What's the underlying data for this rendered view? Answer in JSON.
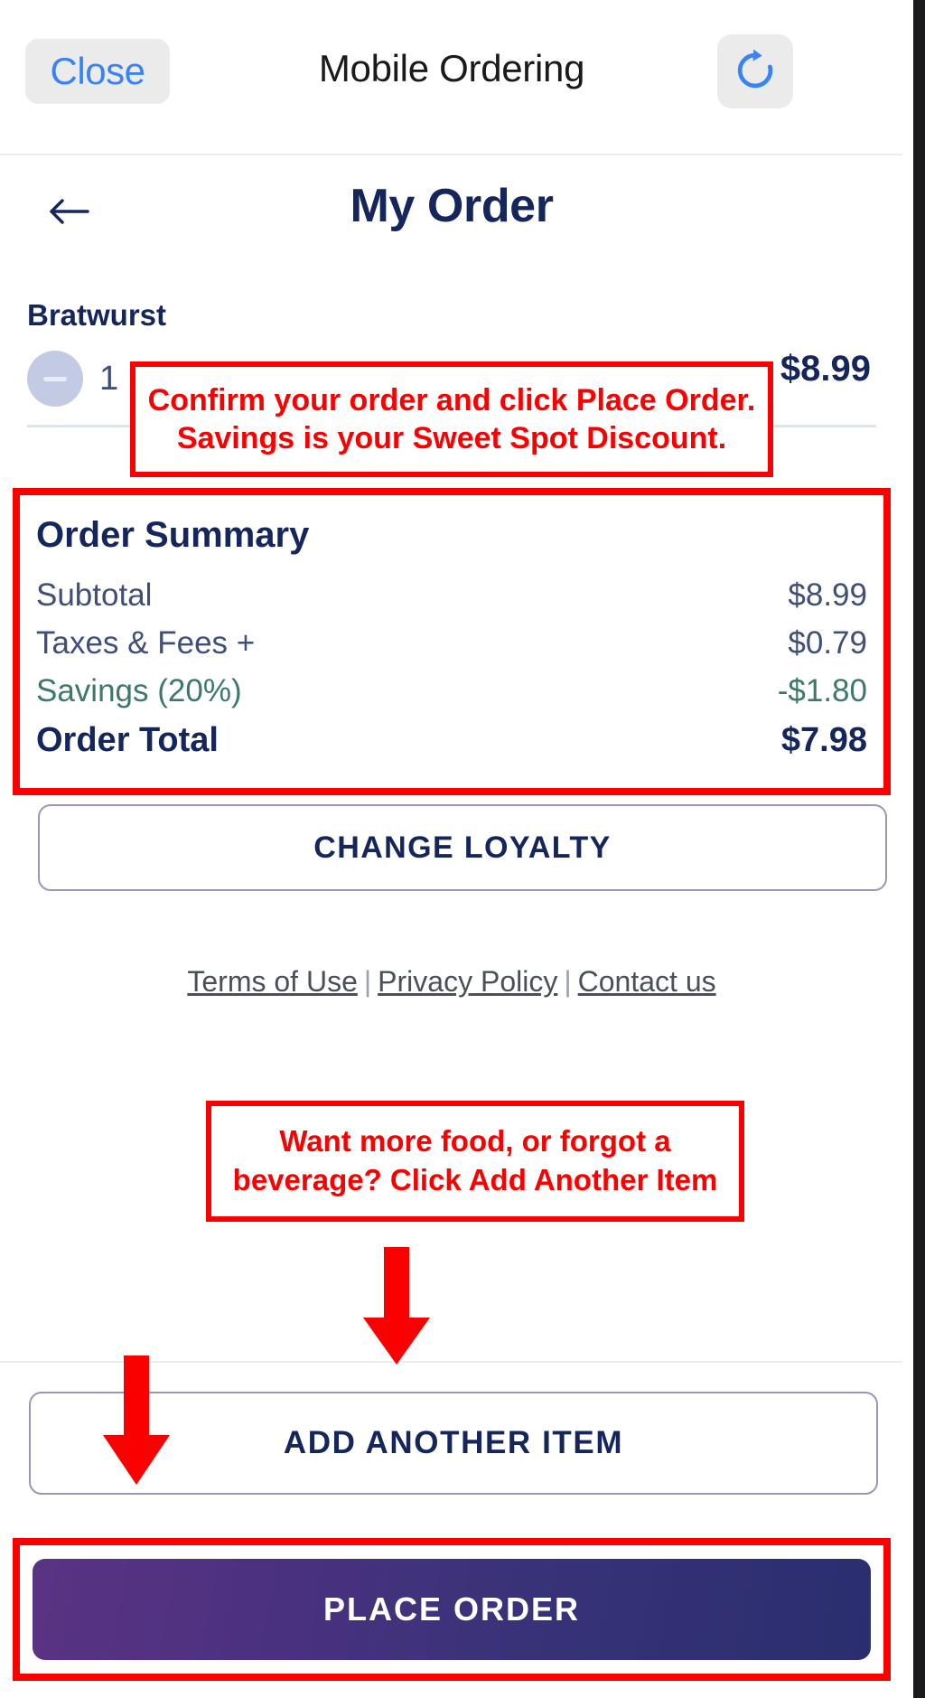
{
  "browser_bar": {
    "close_label": "Close",
    "title": "Mobile Ordering",
    "refresh_icon": "refresh-icon"
  },
  "page_header": {
    "back_icon": "back-arrow-icon",
    "title": "My Order"
  },
  "order_item": {
    "name": "Bratwurst",
    "minus_icon": "minus-circle-icon",
    "quantity": "1",
    "price": "$8.99"
  },
  "order_summary": {
    "title": "Order Summary",
    "rows": [
      {
        "label": "Subtotal",
        "value": "$8.99",
        "style": "normal"
      },
      {
        "label": "Taxes & Fees +",
        "value": "$0.79",
        "style": "normal"
      },
      {
        "label": "Savings (20%)",
        "value": "-$1.80",
        "style": "savings"
      },
      {
        "label": "Order Total",
        "value": "$7.98",
        "style": "total"
      }
    ]
  },
  "loyalty": {
    "button_label": "CHANGE LOYALTY"
  },
  "footer_links": {
    "terms": "Terms of Use",
    "separator": "|",
    "privacy": "Privacy Policy",
    "contact": "Contact us"
  },
  "bottom_actions": {
    "add_item_label": "ADD ANOTHER ITEM",
    "place_order_label": "PLACE ORDER"
  },
  "annotations": {
    "callout_1_line_1": "Confirm your order and click Place Order.",
    "callout_1_line_2": "Savings is your Sweet Spot Discount.",
    "callout_2_line_1": "Want more food, or forgot a",
    "callout_2_line_2": "beverage? Click Add Another Item",
    "arrow_1_icon": "down-arrow-icon",
    "arrow_2_icon": "down-arrow-icon",
    "highlight_summary": "order-summary-highlight",
    "highlight_place_order": "place-order-highlight"
  },
  "colors": {
    "annotation_red": "#fb0000",
    "brand_navy": "#15265c",
    "savings_green": "#3d7a63",
    "accent_blue": "#3a83f7",
    "loyalty_border": "#9d93bb"
  }
}
